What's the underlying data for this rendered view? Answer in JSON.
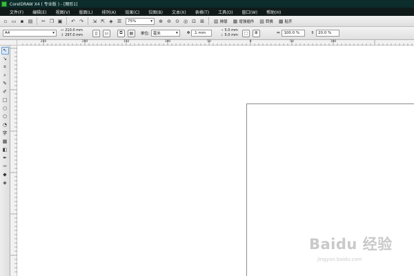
{
  "window": {
    "title": "CorelDRAW X4 ( 专业版 ) - [图形1]"
  },
  "menu": [
    "文件(F)",
    "编辑(E)",
    "视图(V)",
    "版面(L)",
    "排列(A)",
    "效果(C)",
    "位图(B)",
    "文本(X)",
    "表格(T)",
    "工具(O)",
    "窗口(W)",
    "帮助(H)"
  ],
  "toolbar": {
    "zoom_value": "75%",
    "text_buttons": [
      "排版",
      "增强插件",
      "转换",
      "贴齐"
    ]
  },
  "property_bar": {
    "page_size": "A4",
    "width": "210.0 mm",
    "height": "297.0 mm",
    "unit_label": "单位:",
    "unit_value": "毫米",
    "nudge": ".1 mm",
    "dup_x": "5.0 mm",
    "dup_y": "5.0 mm",
    "scale_1": "100.0 %",
    "scale_2": "20.0 %"
  },
  "ruler": {
    "labels": [
      "250",
      "200",
      "150",
      "100",
      "50",
      "0",
      "50",
      "100"
    ]
  },
  "toolbox": {
    "tools": [
      "pick-tool-icon",
      "shape-tool-icon",
      "crop-tool-icon",
      "zoom-tool-icon",
      "freehand-tool-icon",
      "smart-fill-icon",
      "rectangle-tool-icon",
      "ellipse-tool-icon",
      "polygon-tool-icon",
      "basic-shapes-icon",
      "text-tool-icon",
      "table-tool-icon",
      "interactive-blend-icon",
      "eyedropper-icon",
      "outline-tool-icon",
      "fill-tool-icon",
      "interactive-fill-icon"
    ]
  },
  "watermark": {
    "text": "Baidu 经验",
    "url": "jingyan.baidu.com"
  }
}
